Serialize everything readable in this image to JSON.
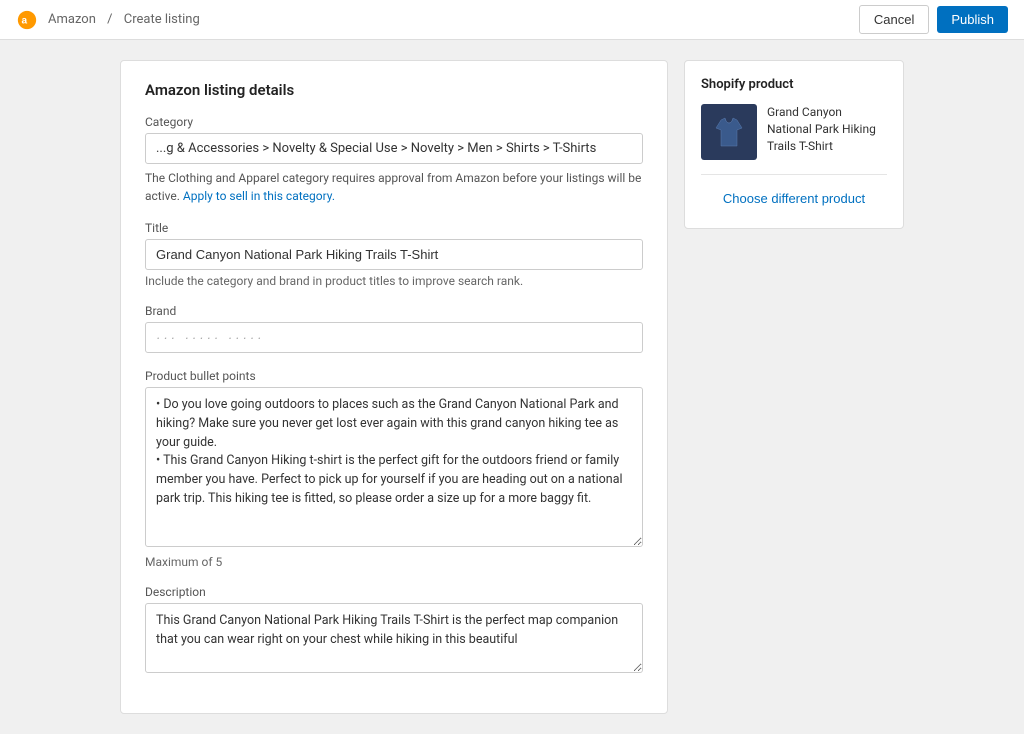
{
  "header": {
    "logo_label": "Amazon",
    "separator": "/",
    "page_title": "Create listing",
    "cancel_label": "Cancel",
    "publish_label": "Publish"
  },
  "listing_panel": {
    "title": "Amazon listing details",
    "category": {
      "label": "Category",
      "value": "...g & Accessories > Novelty & Special Use > Novelty > Men > Shirts > T-Shirts",
      "note_before": "The Clothing and Apparel category requires approval from Amazon before your listings will be active.",
      "note_link": "Apply to sell in this category."
    },
    "title_field": {
      "label": "Title",
      "value": "Grand Canyon National Park Hiking Trails T-Shirt",
      "hint": "Include the category and brand in product titles to improve search rank."
    },
    "brand_field": {
      "label": "Brand",
      "placeholder": "··· ····· ·····"
    },
    "bullet_points": {
      "label": "Product bullet points",
      "content": "• Do you love going outdoors to places such as the Grand Canyon National Park and hiking? Make sure you never get lost ever again with this grand canyon hiking tee as your guide.\n• This Grand Canyon Hiking t-shirt is the perfect gift for the outdoors friend or family member you have. Perfect to pick up for yourself if you are heading out on a national park trip. This hiking tee is fitted, so please order a size up for a more baggy fit.",
      "max_note": "Maximum of 5"
    },
    "description": {
      "label": "Description",
      "content": "This Grand Canyon National Park Hiking Trails T-Shirt is the perfect map companion that you can wear right on your chest while hiking in this beautiful"
    }
  },
  "product_panel": {
    "title": "Shopify product",
    "product_name": "Grand Canyon National Park Hiking Trails T-Shirt",
    "choose_label": "Choose different product"
  }
}
